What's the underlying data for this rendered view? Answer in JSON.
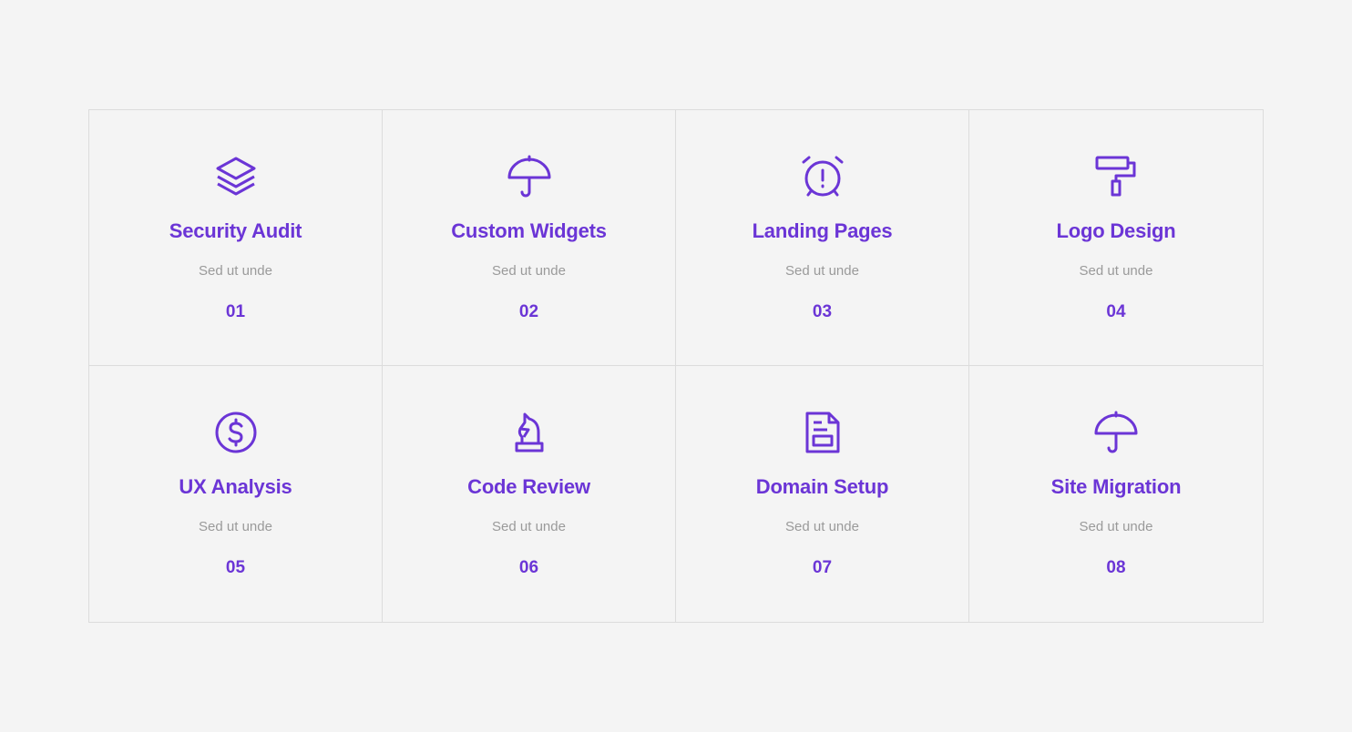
{
  "colors": {
    "accent": "#6b35d6",
    "muted": "#9a9a9a",
    "border": "#dcdcdc",
    "background": "#f4f4f4"
  },
  "services": [
    {
      "title": "Security Audit",
      "subtitle": "Sed ut unde",
      "number": "01",
      "icon": "layers-icon"
    },
    {
      "title": "Custom Widgets",
      "subtitle": "Sed ut unde",
      "number": "02",
      "icon": "umbrella-icon"
    },
    {
      "title": "Landing Pages",
      "subtitle": "Sed ut unde",
      "number": "03",
      "icon": "alarm-clock-icon"
    },
    {
      "title": "Logo Design",
      "subtitle": "Sed ut unde",
      "number": "04",
      "icon": "paint-roller-icon"
    },
    {
      "title": "UX Analysis",
      "subtitle": "Sed ut unde",
      "number": "05",
      "icon": "dollar-coin-icon"
    },
    {
      "title": "Code Review",
      "subtitle": "Sed ut unde",
      "number": "06",
      "icon": "chess-knight-icon"
    },
    {
      "title": "Domain Setup",
      "subtitle": "Sed ut unde",
      "number": "07",
      "icon": "document-icon"
    },
    {
      "title": "Site Migration",
      "subtitle": "Sed ut unde",
      "number": "08",
      "icon": "umbrella-icon"
    }
  ]
}
